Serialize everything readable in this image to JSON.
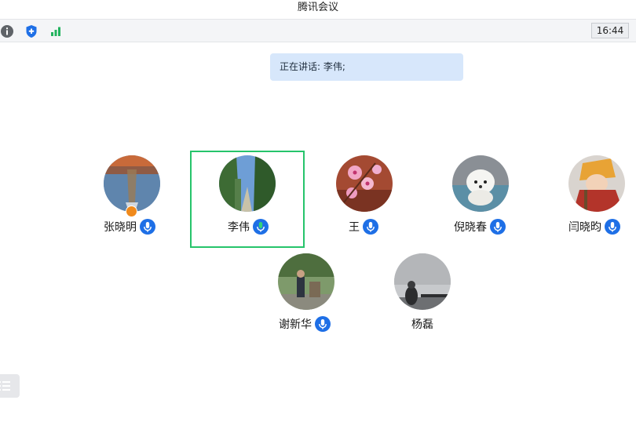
{
  "window": {
    "title": "腾讯会议"
  },
  "toolbar": {
    "icons": [
      "info-icon",
      "shield-icon",
      "signal-icon"
    ],
    "timer": "16:44"
  },
  "speaking": {
    "text": "正在讲话: 李伟;"
  },
  "participants": [
    {
      "name": "张晓明",
      "mic": "unmuted",
      "host": true,
      "speaking": false
    },
    {
      "name": "李伟",
      "mic": "speaking",
      "host": false,
      "speaking": true
    },
    {
      "name": "王",
      "mic": "unmuted",
      "host": false,
      "speaking": false
    },
    {
      "name": "倪晓春",
      "mic": "unmuted",
      "host": false,
      "speaking": false
    },
    {
      "name": "闫晓昀",
      "mic": "unmuted",
      "host": false,
      "speaking": false
    },
    {
      "name": "谢新华",
      "mic": "unmuted",
      "host": false,
      "speaking": false
    },
    {
      "name": "杨磊",
      "mic": "none",
      "host": false,
      "speaking": false
    }
  ],
  "colors": {
    "accent": "#1e6fe6",
    "speaking_green": "#26c46b",
    "active_border": "#26c46b",
    "host_badge": "#f08a1c",
    "banner": "#d7e7fb"
  },
  "sidebar": {
    "list_icon": "list-icon"
  }
}
